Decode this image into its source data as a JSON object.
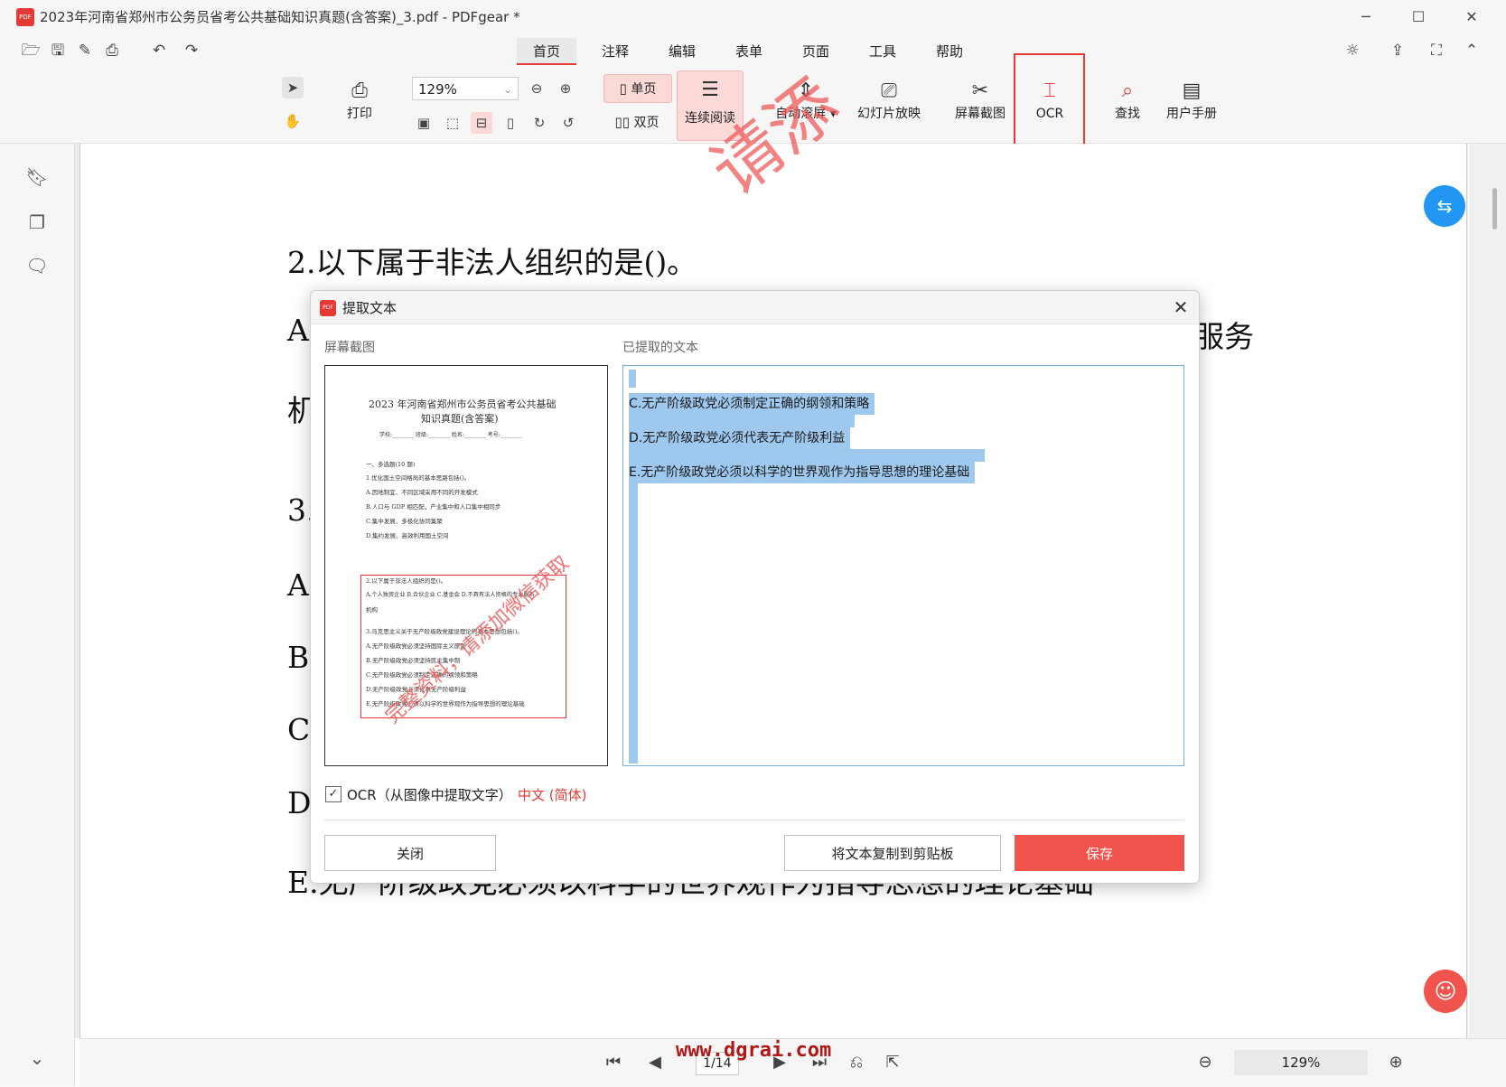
{
  "window": {
    "title": "2023年河南省郑州市公务员省考公共基础知识真题(含答案)_3.pdf - PDFgear *",
    "logo_text": "PDF"
  },
  "menu": {
    "tabs": [
      "首页",
      "注释",
      "编辑",
      "表单",
      "页面",
      "工具",
      "帮助"
    ]
  },
  "toolbar": {
    "print": "打印",
    "zoom_value": "129%",
    "single_page": "单页",
    "double_page": "双页",
    "continuous": "连续阅读",
    "auto_scroll": "自动滚屏",
    "slideshow": "幻灯片放映",
    "screenshot": "屏幕截图",
    "ocr": "OCR",
    "find": "查找",
    "manual": "用户手册"
  },
  "document": {
    "lines": [
      "2.以下属于非法人组织的是()。",
      "A",
      "机",
      "3.",
      "A",
      "B",
      "C",
      "D",
      "E.无产阶级政党必须以科学的世界观作为指导思想的理论基础"
    ],
    "right_fragment": "服务",
    "watermark": "请添"
  },
  "dialog": {
    "title": "提取文本",
    "screenshot_label": "屏幕截图",
    "extracted_label": "已提取的文本",
    "extracted_lines": [
      "C.无产阶级政党必须制定正确的纲领和策略",
      "D.无产阶级政党必须代表无产阶级利益",
      "E.无产阶级政党必须以科学的世界观作为指导思想的理论基础"
    ],
    "ocr_checkbox_label": "OCR（从图像中提取文字）",
    "ocr_language": "中文 (简体)",
    "close_button": "关闭",
    "copy_button": "将文本复制到剪贴板",
    "save_button": "保存",
    "preview": {
      "title_line1": "2023 年河南省郑州市公务员省考公共基础",
      "title_line2": "知识真题(含答案)",
      "form_line": "学校:________ 班级:________ 姓名:________ 考号:________",
      "lines": [
        "一、多选题(10 题)",
        "1.优化国土空间格局的基本思路包括()。",
        "A.因地制宜、不同区域采用不同的开发模式",
        "B.人口与 GDP 相匹配，产业集中和人口集中相同步",
        "C.集中发展、多极化协同集聚",
        "D.集约发展、高效利用国土空间",
        "2.以下属于非法人组织的是()。",
        "A.个人独资企业 B.合伙企业 C.基金会 D.不具有法人资格的专业服务",
        "机构",
        "3.马克思主义关于无产阶级政党建设理论的基本思想包括()。",
        "A.无产阶级政党必须坚持国际主义原则",
        "B.无产阶级政党必须坚持民主集中制",
        "C.无产阶级政党必须制定正确的纲领和策略",
        "D.无产阶级政党必须代表无产阶级利益",
        "E.无产阶级政党必须以科学的世界观作为指导思想的理论基础"
      ],
      "watermark": "完整资料，请添加微信获取"
    }
  },
  "statusbar": {
    "page_indicator": "1/14",
    "zoom": "129%",
    "site_watermark": "www.dgrai.com"
  },
  "colors": {
    "accent": "#e53935",
    "save_button": "#f0544c",
    "selection": "#9ec8ee",
    "word_fab": "#2196f3"
  }
}
